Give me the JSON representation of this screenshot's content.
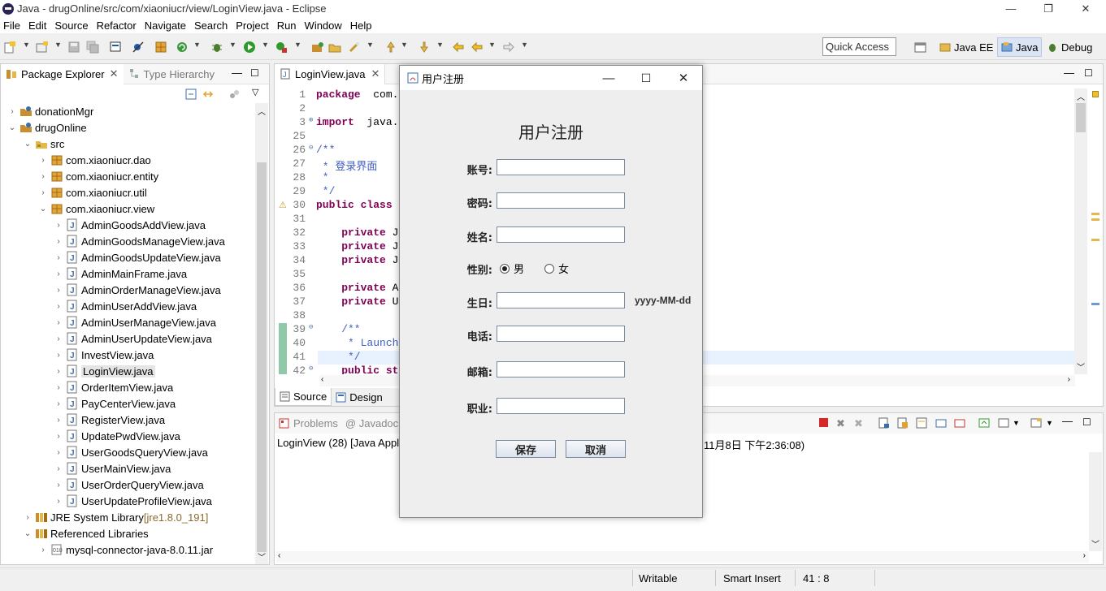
{
  "window": {
    "title": "Java - drugOnline/src/com/xiaoniucr/view/LoginView.java - Eclipse",
    "minimize": "—",
    "maximize": "❐",
    "close": "✕"
  },
  "menu": [
    "File",
    "Edit",
    "Source",
    "Refactor",
    "Navigate",
    "Search",
    "Project",
    "Run",
    "Window",
    "Help"
  ],
  "toolbar": {
    "quick_access_placeholder": "Quick Access"
  },
  "perspectives": [
    {
      "label": "Java EE",
      "active": false
    },
    {
      "label": "Java",
      "active": true
    },
    {
      "label": "Debug",
      "active": false
    }
  ],
  "package_explorer": {
    "tabs": [
      "Package Explorer",
      "Type Hierarchy"
    ],
    "tree": [
      {
        "label": "donationMgr",
        "depth": 0,
        "arrow": "›",
        "icon": "project"
      },
      {
        "label": "drugOnline",
        "depth": 0,
        "arrow": "⌄",
        "icon": "project"
      },
      {
        "label": "src",
        "depth": 1,
        "arrow": "⌄",
        "icon": "folder"
      },
      {
        "label": "com.xiaoniucr.dao",
        "depth": 2,
        "arrow": "›",
        "icon": "package"
      },
      {
        "label": "com.xiaoniucr.entity",
        "depth": 2,
        "arrow": "›",
        "icon": "package"
      },
      {
        "label": "com.xiaoniucr.util",
        "depth": 2,
        "arrow": "›",
        "icon": "package"
      },
      {
        "label": "com.xiaoniucr.view",
        "depth": 2,
        "arrow": "⌄",
        "icon": "package"
      },
      {
        "label": "AdminGoodsAddView.java",
        "depth": 3,
        "arrow": "›",
        "icon": "java"
      },
      {
        "label": "AdminGoodsManageView.java",
        "depth": 3,
        "arrow": "›",
        "icon": "java"
      },
      {
        "label": "AdminGoodsUpdateView.java",
        "depth": 3,
        "arrow": "›",
        "icon": "java"
      },
      {
        "label": "AdminMainFrame.java",
        "depth": 3,
        "arrow": "›",
        "icon": "java"
      },
      {
        "label": "AdminOrderManageView.java",
        "depth": 3,
        "arrow": "›",
        "icon": "java"
      },
      {
        "label": "AdminUserAddView.java",
        "depth": 3,
        "arrow": "›",
        "icon": "java"
      },
      {
        "label": "AdminUserManageView.java",
        "depth": 3,
        "arrow": "›",
        "icon": "java"
      },
      {
        "label": "AdminUserUpdateView.java",
        "depth": 3,
        "arrow": "›",
        "icon": "java"
      },
      {
        "label": "InvestView.java",
        "depth": 3,
        "arrow": "›",
        "icon": "java"
      },
      {
        "label": "LoginView.java",
        "depth": 3,
        "arrow": "›",
        "icon": "java",
        "selected": true
      },
      {
        "label": "OrderItemView.java",
        "depth": 3,
        "arrow": "›",
        "icon": "java"
      },
      {
        "label": "PayCenterView.java",
        "depth": 3,
        "arrow": "›",
        "icon": "java"
      },
      {
        "label": "RegisterView.java",
        "depth": 3,
        "arrow": "›",
        "icon": "java"
      },
      {
        "label": "UpdatePwdView.java",
        "depth": 3,
        "arrow": "›",
        "icon": "java"
      },
      {
        "label": "UserGoodsQueryView.java",
        "depth": 3,
        "arrow": "›",
        "icon": "java"
      },
      {
        "label": "UserMainView.java",
        "depth": 3,
        "arrow": "›",
        "icon": "java"
      },
      {
        "label": "UserOrderQueryView.java",
        "depth": 3,
        "arrow": "›",
        "icon": "java"
      },
      {
        "label": "UserUpdateProfileView.java",
        "depth": 3,
        "arrow": "›",
        "icon": "java"
      },
      {
        "label": "JRE System Library",
        "suffix": " [jre1.8.0_191]",
        "depth": 1,
        "arrow": "›",
        "icon": "library"
      },
      {
        "label": "Referenced Libraries",
        "depth": 1,
        "arrow": "⌄",
        "icon": "library"
      },
      {
        "label": "mysql-connector-java-8.0.11.jar",
        "depth": 2,
        "arrow": "›",
        "icon": "jar"
      }
    ]
  },
  "editor": {
    "tab": "LoginView.java",
    "lines": [
      {
        "n": "1",
        "parts": [
          [
            "kw",
            "package"
          ],
          [
            "",
            "  com.x"
          ]
        ]
      },
      {
        "n": "2",
        "parts": []
      },
      {
        "n": "3",
        "parts": [
          [
            "kw",
            "import"
          ],
          [
            "",
            "  java.a"
          ]
        ]
      },
      {
        "n": "25",
        "parts": []
      },
      {
        "n": "26",
        "parts": [
          [
            "cm",
            "/**"
          ]
        ]
      },
      {
        "n": "27",
        "parts": [
          [
            "cm",
            " * 登录界面"
          ]
        ]
      },
      {
        "n": "28",
        "parts": [
          [
            "cm",
            " *"
          ]
        ]
      },
      {
        "n": "29",
        "parts": [
          [
            "cm",
            " */"
          ]
        ]
      },
      {
        "n": "30",
        "parts": [
          [
            "kw",
            "public class"
          ]
        ]
      },
      {
        "n": "31",
        "parts": []
      },
      {
        "n": "32",
        "parts": [
          [
            "",
            "    "
          ],
          [
            "kw",
            "private"
          ],
          [
            "",
            " J"
          ]
        ]
      },
      {
        "n": "33",
        "parts": [
          [
            "",
            "    "
          ],
          [
            "kw",
            "private"
          ],
          [
            "",
            " J"
          ]
        ]
      },
      {
        "n": "34",
        "parts": [
          [
            "",
            "    "
          ],
          [
            "kw",
            "private"
          ],
          [
            "",
            " J"
          ]
        ]
      },
      {
        "n": "35",
        "parts": []
      },
      {
        "n": "36",
        "parts": [
          [
            "",
            "    "
          ],
          [
            "kw",
            "private"
          ],
          [
            "",
            " A"
          ]
        ]
      },
      {
        "n": "37",
        "parts": [
          [
            "",
            "    "
          ],
          [
            "kw",
            "private"
          ],
          [
            "",
            " U"
          ]
        ]
      },
      {
        "n": "38",
        "parts": []
      },
      {
        "n": "39",
        "parts": [
          [
            "cm",
            "    /**"
          ]
        ]
      },
      {
        "n": "40",
        "parts": [
          [
            "cm",
            "     * Launch"
          ]
        ]
      },
      {
        "n": "41",
        "parts": [
          [
            "cm",
            "     */"
          ]
        ]
      },
      {
        "n": "42",
        "parts": [
          [
            "",
            "    "
          ],
          [
            "kw",
            "public st"
          ]
        ]
      }
    ],
    "bottom_tabs": [
      "Source",
      "Design"
    ]
  },
  "console": {
    "tabs": [
      "Problems",
      "@ Javadoc"
    ],
    "line_left": "LoginView (28) [Java Appli",
    "line_right": "11月8日 下午2:36:08)"
  },
  "statusbar": {
    "writable": "Writable",
    "insert_mode": "Smart Insert",
    "position": "41 : 8"
  },
  "dialog": {
    "title": "用户注册",
    "heading": "用户注册",
    "fields": [
      {
        "label": "账号:",
        "value": ""
      },
      {
        "label": "密码:",
        "value": ""
      },
      {
        "label": "姓名:",
        "value": ""
      },
      {
        "label": "生日:",
        "value": "",
        "hint": "yyyy-MM-dd"
      },
      {
        "label": "电话:",
        "value": ""
      },
      {
        "label": "邮箱:",
        "value": ""
      },
      {
        "label": "职业:",
        "value": ""
      }
    ],
    "gender": {
      "label": "性别:",
      "options": [
        "男",
        "女"
      ],
      "selected": "男"
    },
    "buttons": {
      "save": "保存",
      "cancel": "取消"
    }
  }
}
